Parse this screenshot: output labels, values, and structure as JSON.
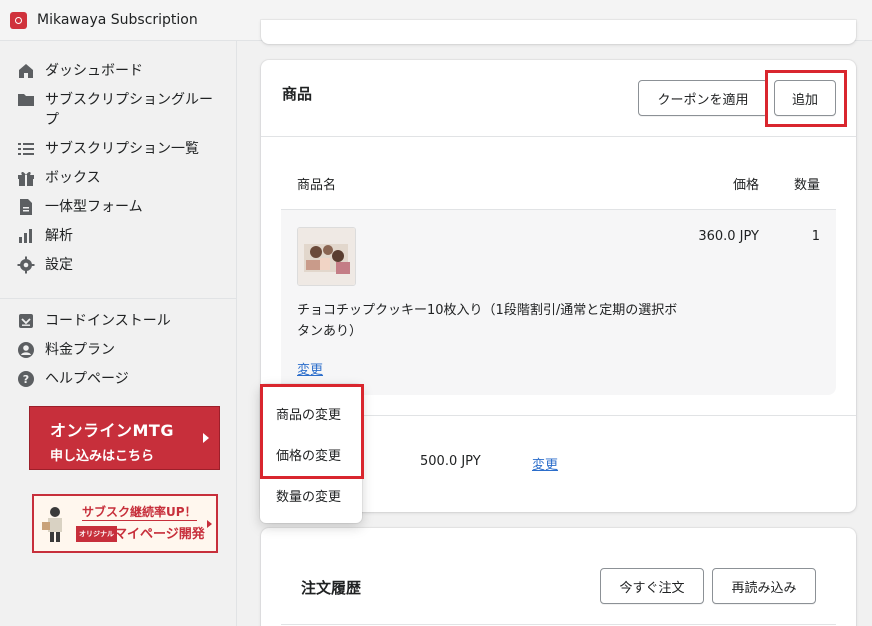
{
  "app": {
    "name": "Mikawaya Subscription"
  },
  "sidebar": {
    "items": [
      {
        "label": "ダッシュボード",
        "icon": "home-icon"
      },
      {
        "label": "サブスクリプショングループ",
        "icon": "folder-icon"
      },
      {
        "label": "サブスクリプション一覧",
        "icon": "list-icon"
      },
      {
        "label": "ボックス",
        "icon": "gift-icon"
      },
      {
        "label": "一体型フォーム",
        "icon": "document-icon"
      },
      {
        "label": "解析",
        "icon": "bar-chart-icon"
      },
      {
        "label": "設定",
        "icon": "gear-icon"
      }
    ],
    "secondary": [
      {
        "label": "コードインストール",
        "icon": "install-icon"
      },
      {
        "label": "料金プラン",
        "icon": "user-icon"
      },
      {
        "label": "ヘルプページ",
        "icon": "help-icon"
      }
    ],
    "banner_mtg": {
      "line1": "オンラインMTG",
      "line2": "申し込みはこちら"
    },
    "banner_sub": {
      "line1": "サブスク継続率UP！",
      "tag": "オリジナル",
      "line2": "マイページ開発"
    }
  },
  "products": {
    "title": "商品",
    "coupon_button": "クーポンを適用",
    "add_button": "追加",
    "columns": {
      "name": "商品名",
      "price": "価格",
      "qty": "数量"
    },
    "item": {
      "name": "チョコチップクッキー10枚入り（1段階割引/通常と定期の選択ボタンあり）",
      "price": "360.0 JPY",
      "qty": "1",
      "change_link": "変更"
    },
    "shipping": {
      "price": "500.0 JPY",
      "change_link": "変更"
    }
  },
  "dropdown": {
    "items": [
      "商品の変更",
      "価格の変更",
      "数量の変更"
    ]
  },
  "history": {
    "title": "注文履歴",
    "order_now_button": "今すぐ注文",
    "reload_button": "再読み込み"
  },
  "colors": {
    "highlight": "#d9262e",
    "brand": "#c72f3b",
    "link": "#2c6ecb"
  }
}
